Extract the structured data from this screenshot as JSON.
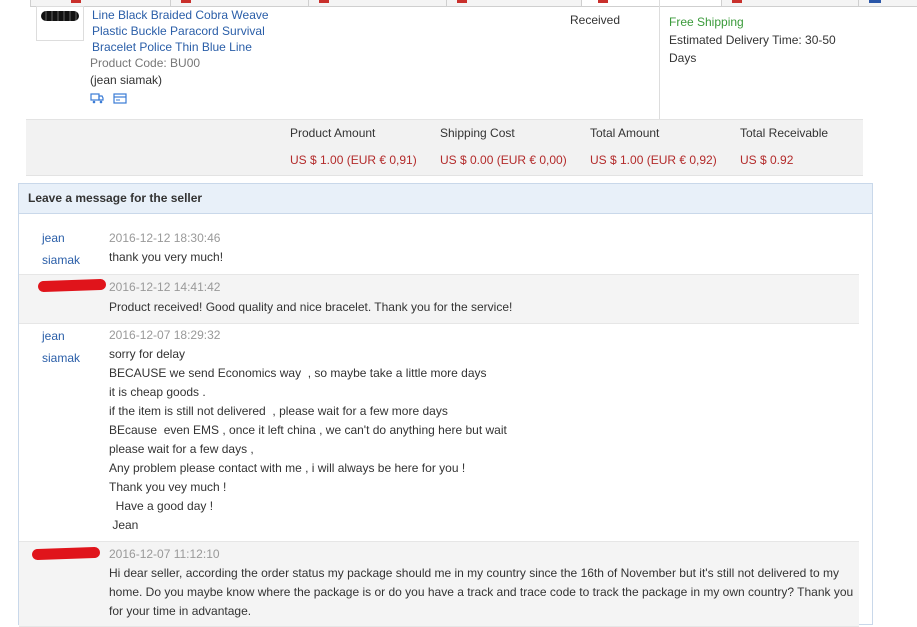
{
  "product": {
    "name": "Line Black Braided Cobra Weave Plastic Buckle Paracord Survival Bracelet Police Thin Blue Line",
    "code": "Product Code: BU00",
    "seller": "(jean siamak)",
    "status": "Received",
    "shipping_method": "Free Shipping",
    "delivery_time": "Estimated Delivery Time: 30-50 Days",
    "icons": [
      "shipping-truck-icon",
      "card-icon"
    ]
  },
  "totals": {
    "product_amount_label": "Product Amount",
    "product_amount_value": "US $ 1.00 (EUR € 0,91)",
    "shipping_cost_label": "Shipping Cost",
    "shipping_cost_value": "US $ 0.00 (EUR € 0,00)",
    "total_amount_label": "Total Amount",
    "total_amount_value": "US $ 1.00 (EUR € 0,92)",
    "total_receivable_label": "Total Receivable",
    "total_receivable_value": "US $ 0.92"
  },
  "messages": {
    "title": "Leave a message for the seller",
    "items": [
      {
        "author_first": "jean",
        "author_last": "siamak",
        "time": "2016-12-12 18:30:46",
        "lines": [
          "thank you very much!"
        ]
      },
      {
        "author_redacted": true,
        "time": "2016-12-12 14:41:42",
        "lines": [
          "Product received! Good quality and nice bracelet. Thank you for the service!"
        ]
      },
      {
        "author_first": "jean",
        "author_last": "siamak",
        "time": "2016-12-07 18:29:32",
        "lines": [
          "sorry for delay",
          "BECAUSE we send Economics way  , so maybe take a little more days",
          "it is cheap goods .",
          "if the item is still not delivered  , please wait for a few more days",
          "BEcause  even EMS , once it left china , we can't do anything here but wait",
          "please wait for a few days ,",
          "Any problem please contact with me , i will always be here for you !",
          "Thank you vey much !",
          "  Have a good day !",
          " Jean"
        ]
      },
      {
        "author_redacted": true,
        "time": "2016-12-07 11:12:10",
        "text": "Hi dear seller, according the order status my package should me in my country since the 16th of November but it's still not delivered to my home. Do you maybe know where the package is or do you have a track and trace code to track the package in my own country? Thank you for your time in advantage."
      }
    ]
  },
  "colors": {
    "link": "#2a5ea8",
    "price": "#b32a2a",
    "free_shipping": "#3a9a3a",
    "redaction": "#e0141b"
  }
}
